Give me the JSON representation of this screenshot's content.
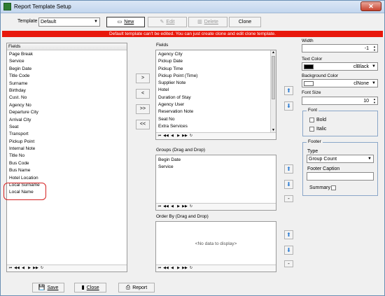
{
  "window": {
    "title": "Report Template Setup",
    "close_glyph": "✕"
  },
  "toolbar": {
    "template_label": "Template",
    "template_value": "Default",
    "new_label": "New",
    "edit_label": "Edit",
    "delete_label": "Delete",
    "clone_label": "Clone"
  },
  "banner": {
    "text": "Default template can't be edited. You can just create clone  and edit clone template."
  },
  "left_fields": {
    "header": "Fields",
    "items": [
      "Page Break",
      "Service",
      "Begin Date",
      "Title Code",
      "Surname",
      "Birthday",
      "Cust. No",
      "Agency No",
      "Departure City",
      "Arrival City",
      "Seat",
      "Transport",
      "Pickup Point",
      "Internal Note",
      "Title No",
      "Bus Code",
      "Bus Name",
      "Hotel Location",
      "Local Surname",
      "Local Name"
    ]
  },
  "move_buttons": {
    "add_one": ">",
    "remove_one": "<",
    "add_all": ">>",
    "remove_all": "<<"
  },
  "selected_fields": {
    "header": "Fields",
    "items": [
      "Agency City",
      "Pickup Date",
      "Pickup Time",
      "Pickup Point (Time)",
      "Supplier Note",
      "Hotel",
      "Duration of Stay",
      "Agency User",
      "Reservation Note",
      "Seat No",
      "Extra Services"
    ]
  },
  "groups": {
    "header": "Groups (Drag and Drop)",
    "items": [
      "Begin Date",
      "Service"
    ]
  },
  "order_by": {
    "header": "Order By (Drag and Drop)",
    "empty_text": "<No data to display>"
  },
  "properties": {
    "width_label": "Width",
    "width_value": "-1",
    "text_color_label": "Text Color",
    "text_color_value": "clBlack",
    "text_color_hex": "#000000",
    "bg_color_label": "Background Color",
    "bg_color_value": "clNone",
    "bg_color_hex": "#ffffff",
    "font_size_label": "Font Size",
    "font_size_value": "10",
    "font_group": "Font",
    "bold_label": "Bold",
    "italic_label": "Italic",
    "footer_group": "Footer",
    "type_label": "Type",
    "type_value": "Group Count",
    "footer_caption_label": "Footer Caption",
    "footer_caption_value": "",
    "summary_label": "Summary"
  },
  "bottom": {
    "save_label": "Save",
    "close_label": "Close",
    "report_label": "Report"
  },
  "colors": {
    "banner": "#e8180c",
    "arrow_blue": "#2b7bd2",
    "highlight": "#d52121"
  }
}
